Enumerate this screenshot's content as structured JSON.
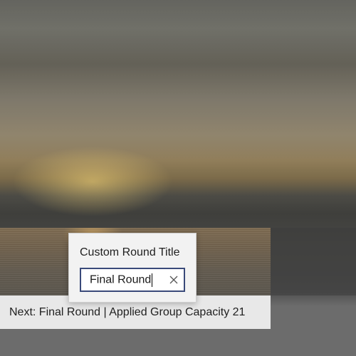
{
  "flyout": {
    "title": "Custom Round Title",
    "input": {
      "value": "Final Round",
      "clear_icon": "close-icon"
    }
  },
  "status_bar": {
    "text": "Next: Final Round | Applied Group Capacity 21"
  },
  "colors": {
    "flyout_background": "#f2f2f2",
    "input_border": "#3a4a7a",
    "status_bar_background": "#e8e8e8"
  }
}
